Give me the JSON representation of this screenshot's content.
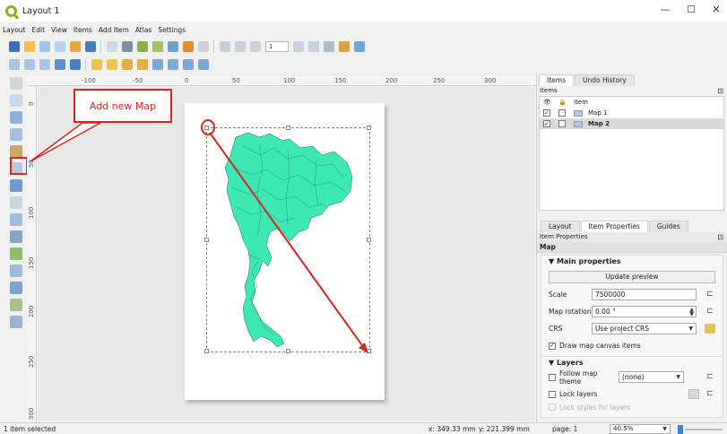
{
  "window": {
    "title": "Layout 1",
    "controls": [
      "—",
      "☐",
      "✕"
    ]
  },
  "menu": [
    "Layout",
    "Edit",
    "View",
    "Items",
    "Add Item",
    "Atlas",
    "Settings"
  ],
  "toolbar": {
    "atlas_page": "1"
  },
  "ruler_top": [
    "-100",
    "-50",
    "0",
    "50",
    "100",
    "150",
    "200",
    "250",
    "300"
  ],
  "ruler_left": [
    "0",
    "50",
    "100",
    "150",
    "200",
    "250",
    "300"
  ],
  "callout": {
    "text": "Add new Map"
  },
  "items_panel": {
    "tabs": [
      "Items",
      "Undo History"
    ],
    "title": "Items",
    "header": "Item",
    "rows": [
      {
        "name": "Map 1",
        "visible": "✓"
      },
      {
        "name": "Map 2",
        "visible": "✓"
      }
    ]
  },
  "props_panel": {
    "tabs": [
      "Layout",
      "Item Properties",
      "Guides"
    ],
    "title": "Item Properties",
    "item_type": "Map",
    "main_properties": "Main properties",
    "update_preview": "Update preview",
    "scale_label": "Scale",
    "scale_value": "7500000",
    "rotation_label": "Map rotation",
    "rotation_value": "0.00 °",
    "crs_label": "CRS",
    "crs_value": "Use project CRS",
    "draw_canvas": "Draw map canvas items",
    "layers_section": "Layers",
    "follow_theme": "Follow map theme",
    "theme_value": "(none)",
    "lock_layers": "Lock layers",
    "lock_styles": "Lock styles for layers"
  },
  "status": {
    "selection": "1 item selected",
    "x": "x: 349.33 mm",
    "y": "y: 221.399 mm",
    "page": "page: 1",
    "zoom": "40.5%"
  },
  "colors": {
    "accent": "#d9261c",
    "map_fill": "#3de8b4",
    "selection": "#d9d9d9"
  }
}
